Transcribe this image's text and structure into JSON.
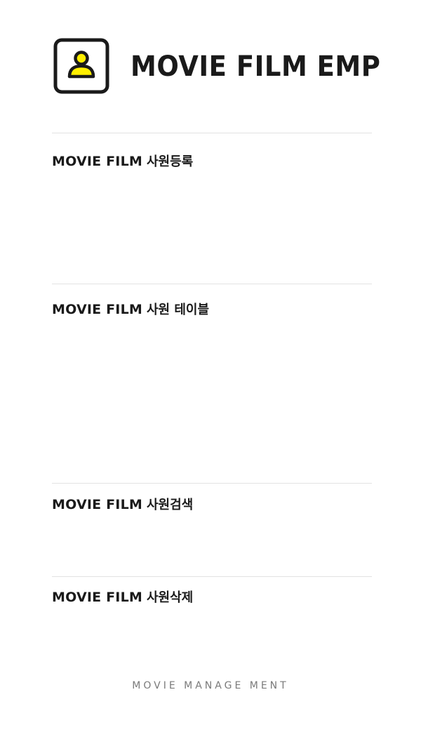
{
  "header": {
    "logo_icon": "user-badge-icon",
    "title": "MOVIE FILM EMP"
  },
  "colors": {
    "accent_yellow": "#FFEF00",
    "text_dark": "#1a1a1a",
    "divider": "#e2e2e2",
    "footer_text": "#7a7a7a"
  },
  "sections": [
    {
      "brand": "MOVIE FILM",
      "title": "사원등록"
    },
    {
      "brand": "MOVIE FILM",
      "title": "사원 테이블"
    },
    {
      "brand": "MOVIE FILM",
      "title": "사원검색"
    },
    {
      "brand": "MOVIE FILM",
      "title": "사원삭제"
    }
  ],
  "footer": {
    "text": "MOVIE MANAGE MENT"
  }
}
